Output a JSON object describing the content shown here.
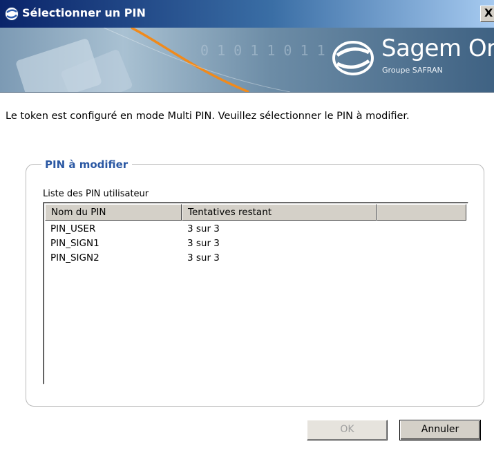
{
  "window": {
    "title": "Sélectionner un PIN",
    "close_label": "X"
  },
  "banner": {
    "brand_name": "Sagem Orga",
    "brand_subtitle": "Groupe SAFRAN",
    "binary_text": "0 1 0 1 1 0 1 1",
    "accent_color": "#f08a1c"
  },
  "instruction": "Le token est configuré en mode Multi PIN. Veuillez sélectionner le PIN à modifier.",
  "group": {
    "legend": "PIN à modifier",
    "list_caption": "Liste des PIN utilisateur",
    "columns": [
      "Nom du PIN",
      "Tentatives restant",
      ""
    ],
    "rows": [
      {
        "name": "PIN_USER",
        "attempts": "3 sur 3"
      },
      {
        "name": "PIN_SIGN1",
        "attempts": "3 sur 3"
      },
      {
        "name": "PIN_SIGN2",
        "attempts": "3 sur 3"
      }
    ]
  },
  "buttons": {
    "ok": "OK",
    "cancel": "Annuler"
  },
  "colors": {
    "title_bar": "#0a246a",
    "legend_text": "#2b58a3",
    "button_face": "#d4d0c8"
  }
}
